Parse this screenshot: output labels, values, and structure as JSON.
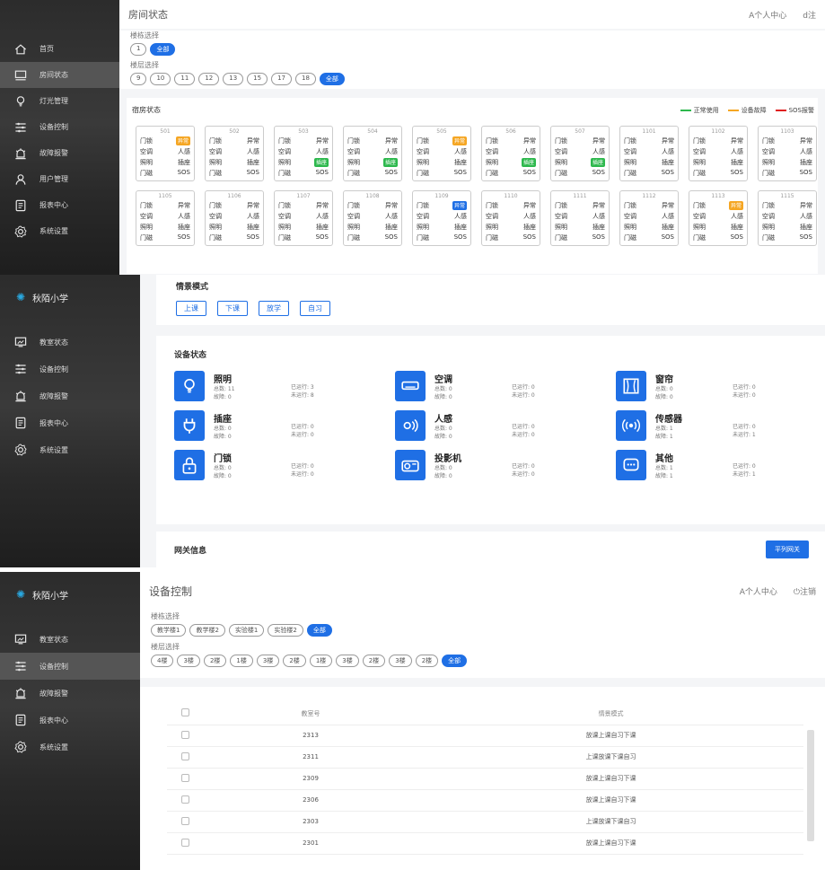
{
  "colors": {
    "accent": "#1f6fe5",
    "normal": "#2db84d",
    "fault": "#f5a623",
    "sos": "#e02020"
  },
  "p1": {
    "sidebar": [
      {
        "label": "首页",
        "icon": "home-icon"
      },
      {
        "label": "房间状态",
        "icon": "monitor-icon"
      },
      {
        "label": "灯光管理",
        "icon": "bulb-icon"
      },
      {
        "label": "设备控制",
        "icon": "sliders-icon"
      },
      {
        "label": "故障报警",
        "icon": "alarm-icon"
      },
      {
        "label": "用户管理",
        "icon": "user-icon"
      },
      {
        "label": "报表中心",
        "icon": "report-icon"
      },
      {
        "label": "系统设置",
        "icon": "settings-icon"
      }
    ],
    "title": "房间状态",
    "user": "A个人中心",
    "logout": "d注",
    "building_label": "楼栋选择",
    "building_chips": [
      "1",
      "全部"
    ],
    "floor_label": "楼层选择",
    "floor_chips": [
      "9",
      "10",
      "11",
      "12",
      "13",
      "15",
      "17",
      "18",
      "全部"
    ],
    "section": "宿房状态",
    "legend": [
      "正常使用",
      "设备故障",
      "SOS报警"
    ],
    "rooms_row1": [
      {
        "num": "501",
        "r1": [
          "门锁",
          "异常"
        ],
        "r2": [
          "空调",
          "人感"
        ],
        "r3": [
          "照明",
          "插座"
        ],
        "r4": [
          "门磁",
          "SOS"
        ],
        "tag": "o"
      },
      {
        "num": "502",
        "r1": [
          "门锁",
          "异常"
        ],
        "r2": [
          "空调",
          "人感"
        ],
        "r3": [
          "照明",
          "插座"
        ],
        "r4": [
          "门磁",
          "SOS"
        ],
        "tag": ""
      },
      {
        "num": "503",
        "r1": [
          "门锁",
          "异常"
        ],
        "r2": [
          "空调",
          "人感"
        ],
        "r3": [
          "照明",
          "插座"
        ],
        "r4": [
          "门磁",
          "SOS"
        ],
        "tag": "g"
      },
      {
        "num": "504",
        "r1": [
          "门锁",
          "异常"
        ],
        "r2": [
          "空调",
          "人感"
        ],
        "r3": [
          "照明",
          "插座"
        ],
        "r4": [
          "门磁",
          "SOS"
        ],
        "tag": "g"
      },
      {
        "num": "505",
        "r1": [
          "门锁",
          "异常"
        ],
        "r2": [
          "空调",
          "人感"
        ],
        "r3": [
          "照明",
          "插座"
        ],
        "r4": [
          "门磁",
          "SOS"
        ],
        "tag": "o"
      },
      {
        "num": "506",
        "r1": [
          "门锁",
          "异常"
        ],
        "r2": [
          "空调",
          "人感"
        ],
        "r3": [
          "照明",
          "插座"
        ],
        "r4": [
          "门磁",
          "SOS"
        ],
        "tag": "g"
      },
      {
        "num": "507",
        "r1": [
          "门锁",
          "异常"
        ],
        "r2": [
          "空调",
          "人感"
        ],
        "r3": [
          "照明",
          "插座"
        ],
        "r4": [
          "门磁",
          "SOS"
        ],
        "tag": "g"
      },
      {
        "num": "1101",
        "r1": [
          "门锁",
          "异常"
        ],
        "r2": [
          "空调",
          "人感"
        ],
        "r3": [
          "照明",
          "插座"
        ],
        "r4": [
          "门磁",
          "SOS"
        ],
        "tag": ""
      },
      {
        "num": "1102",
        "r1": [
          "门锁",
          "异常"
        ],
        "r2": [
          "空调",
          "人感"
        ],
        "r3": [
          "照明",
          "插座"
        ],
        "r4": [
          "门磁",
          "SOS"
        ],
        "tag": ""
      },
      {
        "num": "1103",
        "r1": [
          "门锁",
          "异常"
        ],
        "r2": [
          "空调",
          "人感"
        ],
        "r3": [
          "照明",
          "插座"
        ],
        "r4": [
          "门磁",
          "SOS"
        ],
        "tag": ""
      }
    ],
    "rooms_row2": [
      {
        "num": "1105",
        "r1": [
          "门锁",
          "异常"
        ],
        "r2": [
          "空调",
          "人感"
        ],
        "r3": [
          "照明",
          "插座"
        ],
        "r4": [
          "门磁",
          "SOS"
        ],
        "tag": ""
      },
      {
        "num": "1106",
        "r1": [
          "门锁",
          "异常"
        ],
        "r2": [
          "空调",
          "人感"
        ],
        "r3": [
          "照明",
          "插座"
        ],
        "r4": [
          "门磁",
          "SOS"
        ],
        "tag": ""
      },
      {
        "num": "1107",
        "r1": [
          "门锁",
          "异常"
        ],
        "r2": [
          "空调",
          "人感"
        ],
        "r3": [
          "照明",
          "插座"
        ],
        "r4": [
          "门磁",
          "SOS"
        ],
        "tag": ""
      },
      {
        "num": "1108",
        "r1": [
          "门锁",
          "异常"
        ],
        "r2": [
          "空调",
          "人感"
        ],
        "r3": [
          "照明",
          "插座"
        ],
        "r4": [
          "门磁",
          "SOS"
        ],
        "tag": ""
      },
      {
        "num": "1109",
        "r1": [
          "门锁",
          "异常"
        ],
        "r2": [
          "空调",
          "人感"
        ],
        "r3": [
          "照明",
          "插座"
        ],
        "r4": [
          "门磁",
          "SOS"
        ],
        "tag": "b"
      },
      {
        "num": "1110",
        "r1": [
          "门锁",
          "异常"
        ],
        "r2": [
          "空调",
          "人感"
        ],
        "r3": [
          "照明",
          "插座"
        ],
        "r4": [
          "门磁",
          "SOS"
        ],
        "tag": ""
      },
      {
        "num": "1111",
        "r1": [
          "门锁",
          "异常"
        ],
        "r2": [
          "空调",
          "人感"
        ],
        "r3": [
          "照明",
          "插座"
        ],
        "r4": [
          "门磁",
          "SOS"
        ],
        "tag": ""
      },
      {
        "num": "1112",
        "r1": [
          "门锁",
          "异常"
        ],
        "r2": [
          "空调",
          "人感"
        ],
        "r3": [
          "照明",
          "插座"
        ],
        "r4": [
          "门磁",
          "SOS"
        ],
        "tag": ""
      },
      {
        "num": "1113",
        "r1": [
          "门锁",
          "异常"
        ],
        "r2": [
          "空调",
          "人感"
        ],
        "r3": [
          "照明",
          "插座"
        ],
        "r4": [
          "门磁",
          "SOS"
        ],
        "tag": "o"
      },
      {
        "num": "1115",
        "r1": [
          "门锁",
          "异常"
        ],
        "r2": [
          "空调",
          "人感"
        ],
        "r3": [
          "照明",
          "插座"
        ],
        "r4": [
          "门磁",
          "SOS"
        ],
        "tag": ""
      }
    ]
  },
  "p2": {
    "brand": "秋陌小学",
    "sidebar": [
      {
        "label": "教室状态",
        "icon": "classroom-icon"
      },
      {
        "label": "设备控制",
        "icon": "sliders-icon"
      },
      {
        "label": "故障报警",
        "icon": "alarm-icon"
      },
      {
        "label": "报表中心",
        "icon": "report-icon"
      },
      {
        "label": "系统设置",
        "icon": "settings-icon"
      }
    ],
    "mode_title": "情景模式",
    "modes": [
      "上课",
      "下课",
      "放学",
      "自习"
    ],
    "device_title": "设备状态",
    "devices": [
      {
        "name": "照明",
        "icon": "bulb-icon",
        "total": "总数: 11",
        "fault": "故障: 0",
        "running": "已运行: 3",
        "stopped": "未运行: 8"
      },
      {
        "name": "空调",
        "icon": "ac-icon",
        "total": "总数: 0",
        "fault": "故障: 0",
        "running": "已运行: 0",
        "stopped": "未运行: 0"
      },
      {
        "name": "窗帘",
        "icon": "curtain-icon",
        "total": "总数: 0",
        "fault": "故障: 0",
        "running": "已运行: 0",
        "stopped": "未运行: 0"
      },
      {
        "name": "插座",
        "icon": "plug-icon",
        "total": "总数: 0",
        "fault": "故障: 0",
        "running": "已运行: 0",
        "stopped": "未运行: 0"
      },
      {
        "name": "人感",
        "icon": "motion-icon",
        "total": "总数: 0",
        "fault": "故障: 0",
        "running": "已运行: 0",
        "stopped": "未运行: 0"
      },
      {
        "name": "传感器",
        "icon": "sensor-icon",
        "total": "总数: 1",
        "fault": "故障: 1",
        "running": "已运行: 0",
        "stopped": "未运行: 1"
      },
      {
        "name": "门锁",
        "icon": "lock-icon",
        "total": "总数: 0",
        "fault": "故障: 0",
        "running": "已运行: 0",
        "stopped": "未运行: 0"
      },
      {
        "name": "投影机",
        "icon": "projector-icon",
        "total": "总数: 0",
        "fault": "故障: 0",
        "running": "已运行: 0",
        "stopped": "未运行: 0"
      },
      {
        "name": "其他",
        "icon": "other-icon",
        "total": "总数: 1",
        "fault": "故障: 1",
        "running": "已运行: 0",
        "stopped": "未运行: 1"
      }
    ],
    "gateway_title": "网关信息",
    "gateway_button": "平列网关"
  },
  "p3": {
    "brand": "秋陌小学",
    "sidebar": [
      {
        "label": "教室状态",
        "icon": "classroom-icon"
      },
      {
        "label": "设备控制",
        "icon": "sliders-icon"
      },
      {
        "label": "故障报警",
        "icon": "alarm-icon"
      },
      {
        "label": "报表中心",
        "icon": "report-icon"
      },
      {
        "label": "系统设置",
        "icon": "settings-icon"
      }
    ],
    "title": "设备控制",
    "user": "A个人中心",
    "logout": "⏻注销",
    "building_label": "楼栋选择",
    "building_chips": [
      "教学楼1",
      "教学楼2",
      "实验楼1",
      "实验楼2",
      "全部"
    ],
    "floor_label": "楼层选择",
    "floor_chips": [
      "4楼",
      "3楼",
      "2楼",
      "1楼",
      "3楼",
      "2楼",
      "1楼",
      "3楼",
      "2楼",
      "3楼",
      "2楼",
      "全部"
    ],
    "table_headers": [
      "教室号",
      "情景模式"
    ],
    "rows": [
      {
        "room": "2313",
        "mode": "放课上课自习下课"
      },
      {
        "room": "2311",
        "mode": "上课放课下课自习"
      },
      {
        "room": "2309",
        "mode": "放课上课自习下课"
      },
      {
        "room": "2306",
        "mode": "放课上课自习下课"
      },
      {
        "room": "2303",
        "mode": "上课放课下课自习"
      },
      {
        "room": "2301",
        "mode": "放课上课自习下课"
      }
    ]
  }
}
